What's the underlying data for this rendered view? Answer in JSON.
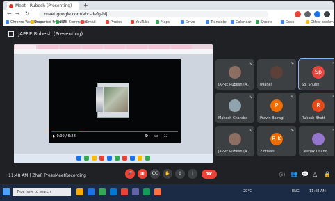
{
  "browser": {
    "tab_title": "Meet - Rubesh (Presenting)",
    "new_tab": "+",
    "url": "meet.google.com/abc-defg-hij",
    "nav": {
      "back": "←",
      "forward": "→",
      "reload": "↻"
    },
    "bookmarks": [
      {
        "label": "Chrome Web Store",
        "color": "#4285f4"
      },
      {
        "label": "Imported From IE",
        "color": "#fbbc04"
      },
      {
        "label": "B2B Commerce",
        "color": "#34a853"
      },
      {
        "label": "Gmail",
        "color": "#ea4335"
      },
      {
        "label": "Photos",
        "color": "#ea4335"
      },
      {
        "label": "YouTube",
        "color": "#ea4335"
      },
      {
        "label": "Maps",
        "color": "#34a853"
      },
      {
        "label": "Drive",
        "color": "#4285f4"
      },
      {
        "label": "Translate",
        "color": "#4285f4"
      },
      {
        "label": "Calendar",
        "color": "#4285f4"
      },
      {
        "label": "Sheets",
        "color": "#34a853"
      },
      {
        "label": "Docs",
        "color": "#4285f4"
      },
      {
        "label": "Other bookmarks",
        "color": "#fbbc04"
      }
    ]
  },
  "meet": {
    "presenting_label": "JAPRE Rubesh (Presenting)",
    "player": {
      "time": "0:00 / 6:28"
    },
    "participants": [
      {
        "name": "JAPRE Rubesh (A...",
        "initial": "",
        "avatar_color": "#8d6e63",
        "active": false
      },
      {
        "name": "(Mahe)",
        "initial": "",
        "avatar_color": "#5d4037",
        "active": false
      },
      {
        "name": "Sp. Shubh",
        "initial": "Sp",
        "avatar_color": "#e8453c",
        "active": true
      },
      {
        "name": "Mahesh Chandra",
        "initial": "",
        "avatar_color": "#90a4ae",
        "active": false
      },
      {
        "name": "Pravin Bairagi",
        "initial": "P",
        "avatar_color": "#ef6c00",
        "active": false
      },
      {
        "name": "Rubesh Bhatt",
        "initial": "R",
        "avatar_color": "#e64a19",
        "active": false
      },
      {
        "name": "JAPRE Rubesh (A...",
        "initial": "",
        "avatar_color": "#8d6e63",
        "active": false
      },
      {
        "name": "2 others",
        "initial": "R K",
        "avatar_color": "#ef6c00",
        "active": false
      },
      {
        "name": "Deepak Chand",
        "initial": "",
        "avatar_color": "#9575cd",
        "active": false
      }
    ],
    "meeting_info": "11:48 AM | ZhaF PressMeetRecording",
    "controls": [
      "mic",
      "cam",
      "cc",
      "raise",
      "present",
      "more"
    ],
    "end_call_icon": "☎"
  },
  "taskbar": {
    "search_placeholder": "Type here to search",
    "clock": "11:48 AM",
    "tray_temp": "29°C",
    "lang": "ENG"
  }
}
